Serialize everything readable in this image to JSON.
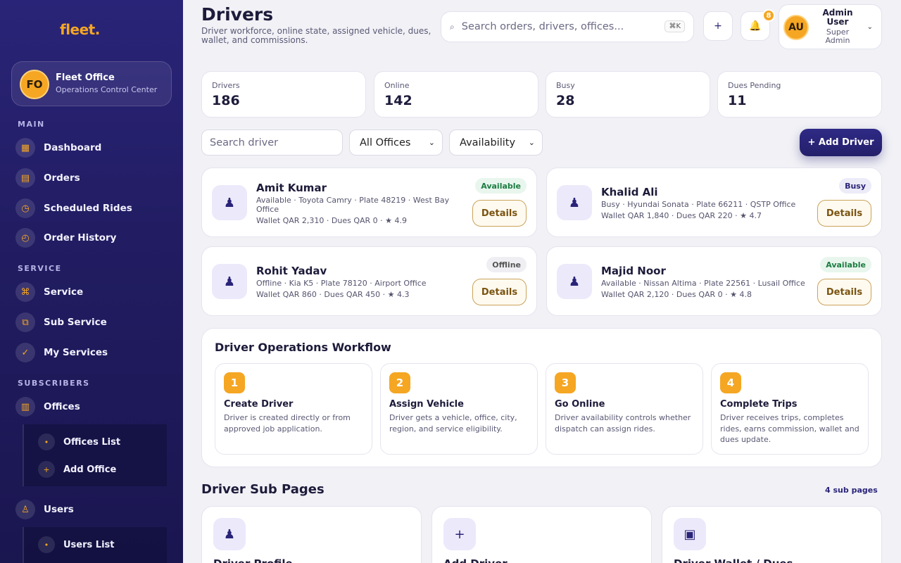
{
  "brand": {
    "logo": "fleet."
  },
  "office": {
    "initials": "FO",
    "name": "Fleet Office",
    "subtitle": "Operations Control Center"
  },
  "sidebar": {
    "sections": [
      "MAIN",
      "SERVICE",
      "SUBSCRIBERS"
    ],
    "main": [
      {
        "label": "Dashboard",
        "icon": "▦"
      },
      {
        "label": "Orders",
        "icon": "▤"
      },
      {
        "label": "Scheduled Rides",
        "icon": "◷"
      },
      {
        "label": "Order History",
        "icon": "◴"
      }
    ],
    "service": [
      {
        "label": "Service",
        "icon": "⌘"
      },
      {
        "label": "Sub Service",
        "icon": "⧉"
      },
      {
        "label": "My Services",
        "icon": "✓"
      }
    ],
    "subscribers": [
      {
        "label": "Offices",
        "icon": "▥"
      },
      {
        "label": "Users",
        "icon": "♙"
      }
    ],
    "offices_sub": [
      {
        "label": "Offices List",
        "icon": "•"
      },
      {
        "label": "Add Office",
        "icon": "+"
      }
    ],
    "users_sub": [
      {
        "label": "Users List",
        "icon": "•"
      }
    ]
  },
  "header": {
    "title": "Drivers",
    "subtitle": "Driver workforce, online state, assigned vehicle, dues, wallet, and commissions.",
    "search_placeholder": "Search orders, drivers, offices...",
    "search_shortcut": "⌘K",
    "add_icon": "+",
    "bell_icon": "🔔",
    "notification_count": "8",
    "user": {
      "initials": "AU",
      "name": "Admin User",
      "role": "Super Admin",
      "chevron": "⌄"
    }
  },
  "stats": [
    {
      "label": "Drivers",
      "value": "186"
    },
    {
      "label": "Online",
      "value": "142"
    },
    {
      "label": "Busy",
      "value": "28"
    },
    {
      "label": "Dues Pending",
      "value": "11"
    }
  ],
  "filters": {
    "search_placeholder": "Search driver",
    "office_select": "All Offices",
    "availability_select": "Availability",
    "add_button": "+ Add Driver"
  },
  "drivers": [
    {
      "name": "Amit Kumar",
      "info": "Available · Toyota Camry · Plate 48219 · West Bay Office",
      "wallet": "Wallet QAR 2,310 · Dues QAR 0 · ★ 4.9",
      "status": "Available",
      "details": "Details"
    },
    {
      "name": "Khalid Ali",
      "info": "Busy · Hyundai Sonata · Plate 66211 · QSTP Office",
      "wallet": "Wallet QAR 1,840 · Dues QAR 220 · ★ 4.7",
      "status": "Busy",
      "details": "Details"
    },
    {
      "name": "Rohit Yadav",
      "info": "Offline · Kia K5 · Plate 78120 · Airport Office",
      "wallet": "Wallet QAR 860 · Dues QAR 450 · ★ 4.3",
      "status": "Offline",
      "details": "Details"
    },
    {
      "name": "Majid Noor",
      "info": "Available · Nissan Altima · Plate 22561 · Lusail Office",
      "wallet": "Wallet QAR 2,120 · Dues QAR 0 · ★ 4.8",
      "status": "Available",
      "details": "Details"
    }
  ],
  "workflow": {
    "title": "Driver Operations Workflow",
    "steps": [
      {
        "num": "1",
        "title": "Create Driver",
        "desc": "Driver is created directly or from approved job application."
      },
      {
        "num": "2",
        "title": "Assign Vehicle",
        "desc": "Driver gets a vehicle, office, city, region, and service eligibility."
      },
      {
        "num": "3",
        "title": "Go Online",
        "desc": "Driver availability controls whether dispatch can assign rides."
      },
      {
        "num": "4",
        "title": "Complete Trips",
        "desc": "Driver receives trips, completes rides, earns commission, wallet and dues update."
      }
    ]
  },
  "subpages": {
    "title": "Driver Sub Pages",
    "count": "4 sub pages",
    "cards": [
      {
        "name": "Driver Profile",
        "icon": "♟"
      },
      {
        "name": "Add Driver",
        "icon": "+"
      },
      {
        "name": "Driver Wallet / Dues",
        "icon": "▣"
      }
    ]
  },
  "colors": {
    "brand": "#2a2478",
    "accent": "#f5a623",
    "available": "#1c7c41"
  }
}
